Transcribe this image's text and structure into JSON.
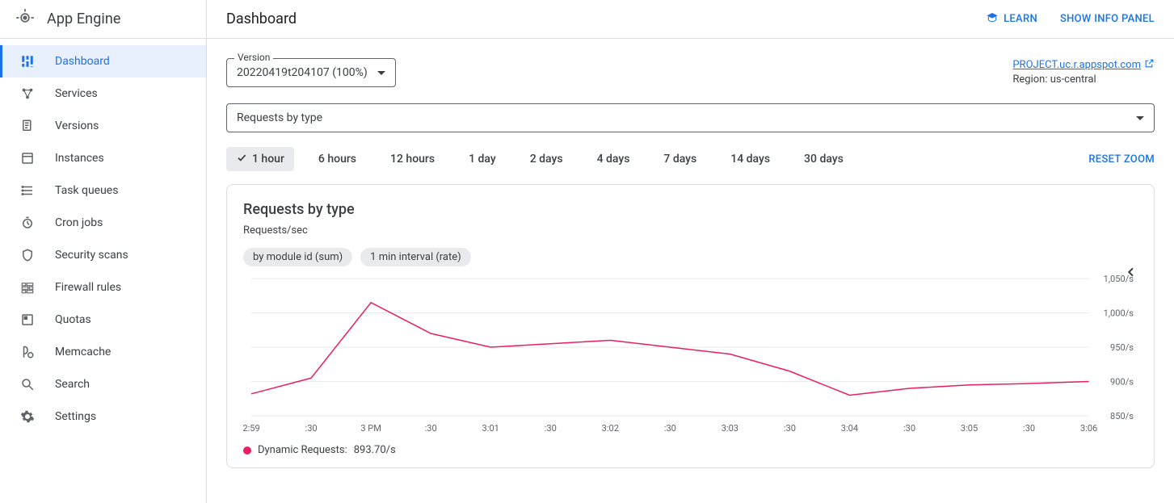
{
  "app_name": "App Engine",
  "sidebar": {
    "items": [
      {
        "label": "Dashboard"
      },
      {
        "label": "Services"
      },
      {
        "label": "Versions"
      },
      {
        "label": "Instances"
      },
      {
        "label": "Task queues"
      },
      {
        "label": "Cron jobs"
      },
      {
        "label": "Security scans"
      },
      {
        "label": "Firewall rules"
      },
      {
        "label": "Quotas"
      },
      {
        "label": "Memcache"
      },
      {
        "label": "Search"
      },
      {
        "label": "Settings"
      }
    ]
  },
  "header": {
    "title": "Dashboard",
    "learn_label": "LEARN",
    "info_panel_label": "SHOW INFO PANEL"
  },
  "version_selector": {
    "label": "Version",
    "value": "20220419t204107 (100%)"
  },
  "project": {
    "url_label": "PROJECT.uc.r.appspot.com",
    "region_label": "Region: us-central"
  },
  "metric_selector": {
    "value": "Requests by type"
  },
  "time_ranges": {
    "items": [
      {
        "label": "1 hour"
      },
      {
        "label": "6 hours"
      },
      {
        "label": "12 hours"
      },
      {
        "label": "1 day"
      },
      {
        "label": "2 days"
      },
      {
        "label": "4 days"
      },
      {
        "label": "7 days"
      },
      {
        "label": "14 days"
      },
      {
        "label": "30 days"
      }
    ],
    "reset_label": "RESET ZOOM"
  },
  "chart": {
    "title": "Requests by type",
    "subtitle": "Requests/sec",
    "badges": [
      "by module id (sum)",
      "1 min interval (rate)"
    ],
    "legend_label": "Dynamic Requests:",
    "legend_value": "893.70/s"
  },
  "chart_data": {
    "type": "line",
    "ylabel": "Requests/sec",
    "xlabel": "",
    "ylim": [
      850,
      1050
    ],
    "y_ticks": [
      "1,050/s",
      "1,000/s",
      "950/s",
      "900/s",
      "850/s"
    ],
    "x_ticks": [
      "2:59",
      ":30",
      "3 PM",
      ":30",
      "3:01",
      ":30",
      "3:02",
      ":30",
      "3:03",
      ":30",
      "3:04",
      ":30",
      "3:05",
      ":30",
      "3:06"
    ],
    "series": [
      {
        "name": "Dynamic Requests",
        "color": "#e91e63",
        "x": [
          "2:59",
          ":30",
          "3 PM",
          ":30",
          "3:01",
          ":30",
          "3:02",
          ":30",
          "3:03",
          ":30",
          "3:04",
          ":30",
          "3:05",
          ":30",
          "3:06"
        ],
        "values": [
          882,
          905,
          1015,
          970,
          950,
          955,
          960,
          950,
          940,
          915,
          880,
          890,
          895,
          897,
          900
        ]
      }
    ]
  }
}
